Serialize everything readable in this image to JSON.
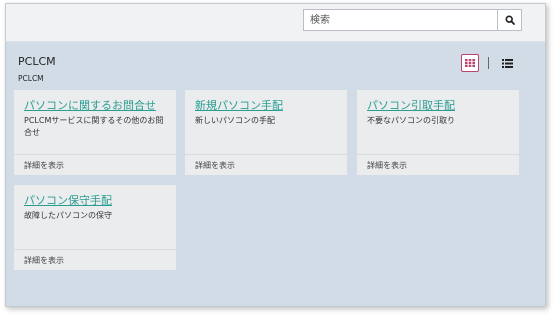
{
  "search": {
    "placeholder": "検索"
  },
  "page": {
    "title": "PCLCM",
    "subtitle": "PCLCM"
  },
  "cards": [
    {
      "title": "パソコンに関するお問合せ",
      "description": "PCLCMサービスに関するその他のお問合せ",
      "footer": "詳細を表示"
    },
    {
      "title": "新規パソコン手配",
      "description": "新しいパソコンの手配",
      "footer": "詳細を表示"
    },
    {
      "title": "パソコン引取手配",
      "description": "不要なパソコンの引取り",
      "footer": "詳細を表示"
    },
    {
      "title": "パソコン保守手配",
      "description": "故障したパソコンの保守",
      "footer": "詳細を表示"
    }
  ],
  "colors": {
    "accent": "#b8446f",
    "link": "#2a9d8f",
    "background": "#d2dce6",
    "card": "#eaecee"
  },
  "icons": {
    "search": "search-icon",
    "grid_view": "grid-view-icon",
    "list_view": "list-view-icon"
  }
}
